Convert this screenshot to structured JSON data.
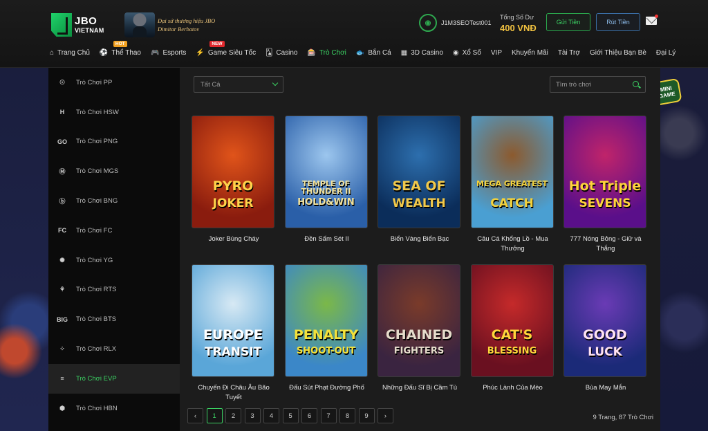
{
  "header": {
    "logo": {
      "line1": "JBO",
      "line2": "VIETNAM"
    },
    "ambassador": {
      "line1": "Đại sứ thương hiệu JBO",
      "line2": "Dimitar Berbatov"
    },
    "user": {
      "name": "J1M3SEOTest001"
    },
    "balance": {
      "label": "Tổng Số Dư",
      "value": "400 VNĐ"
    },
    "deposit_label": "Gửi Tiền",
    "withdraw_label": "Rút Tiền"
  },
  "nav": [
    {
      "label": "Trang Chủ",
      "icon": "home-icon",
      "glyph": "⌂"
    },
    {
      "label": "Thể Thao",
      "icon": "soccer-ball-icon",
      "glyph": "⚽",
      "badge": "HOT"
    },
    {
      "label": "Esports",
      "icon": "gamepad-icon",
      "glyph": "🎮"
    },
    {
      "label": "Game Siêu Tốc",
      "icon": "lightning-icon",
      "glyph": "⚡",
      "badge": "NEW"
    },
    {
      "label": "Casino",
      "icon": "cards-icon",
      "glyph": "🂡"
    },
    {
      "label": "Trò Chơi",
      "icon": "slot-machine-icon",
      "glyph": "🎰"
    },
    {
      "label": "Bắn Cá",
      "icon": "fish-icon",
      "glyph": "🐟"
    },
    {
      "label": "3D Casino",
      "icon": "cube-icon",
      "glyph": "▦"
    },
    {
      "label": "Xổ Số",
      "icon": "lottery-ball-icon",
      "glyph": "◉"
    },
    {
      "label": "VIP"
    },
    {
      "label": "Khuyến Mãi"
    },
    {
      "label": "Tài Trợ"
    },
    {
      "label": "Giới Thiệu Bạn Bè"
    },
    {
      "label": "Đại Lý"
    }
  ],
  "mini_game": {
    "line1": "MINI",
    "line2": "GAME"
  },
  "sidebar": [
    {
      "label": "Trò Chơi PP",
      "icon": "pp-logo-icon",
      "glyph": "☉"
    },
    {
      "label": "Trò Chơi HSW",
      "icon": "hsw-logo-icon",
      "glyph": "H"
    },
    {
      "label": "Trò Chơi PNG",
      "icon": "png-logo-icon",
      "glyph": "GO"
    },
    {
      "label": "Trò Chơi MGS",
      "icon": "mgs-logo-icon",
      "glyph": "Ⓜ"
    },
    {
      "label": "Trò Chơi BNG",
      "icon": "bng-logo-icon",
      "glyph": "ⓑ"
    },
    {
      "label": "Trò Chơi FC",
      "icon": "fc-logo-icon",
      "glyph": "FC"
    },
    {
      "label": "Trò Chơi YG",
      "icon": "yg-logo-icon",
      "glyph": "✺"
    },
    {
      "label": "Trò Chơi RTS",
      "icon": "rts-logo-icon",
      "glyph": "⚘"
    },
    {
      "label": "Trò Chơi BTS",
      "icon": "bts-logo-icon",
      "glyph": "BIG"
    },
    {
      "label": "Trò Chơi RLX",
      "icon": "rlx-logo-icon",
      "glyph": "⁘"
    },
    {
      "label": "Trò Chơi EVP",
      "icon": "evp-logo-icon",
      "glyph": "≡",
      "active": true
    },
    {
      "label": "Trò Chơi HBN",
      "icon": "hbn-logo-icon",
      "glyph": "⬢"
    }
  ],
  "filter": {
    "selected": "Tất Cả"
  },
  "search": {
    "placeholder": "Tìm trò chơi"
  },
  "games": [
    {
      "name": "Joker Bùng Cháy",
      "title": "PYRO",
      "sub": "JOKER",
      "bg": "#8a1c0e",
      "bg2": "#e0541a",
      "fg": "#ffd24a"
    },
    {
      "name": "Đền Sấm Sét II",
      "title": "TEMPLE OF THUNDER II",
      "sub": "HOLD&WIN",
      "bg": "#2a5fa8",
      "bg2": "#9cc6ee",
      "fg": "#f3e29a"
    },
    {
      "name": "Biển Vàng Biển Bạc",
      "title": "SEA OF",
      "sub": "WEALTH",
      "bg": "#0b2d5a",
      "bg2": "#2d6fae",
      "fg": "#f1c94b"
    },
    {
      "name": "Câu Cá Khổng Lồ - Mua Thưởng",
      "title": "MEGA GREATEST",
      "sub": "CATCH",
      "bg": "#4a9fd2",
      "bg2": "#8c5a2e",
      "fg": "#f4d23b"
    },
    {
      "name": "777 Nóng Bỏng - Giữ và Thắng",
      "title": "Hot Triple",
      "sub": "SEVENS",
      "bg": "#5a0f8a",
      "bg2": "#c0246a",
      "fg": "#ffd43b"
    },
    {
      "name": "Chuyến Đi Châu Âu Bão Tuyết",
      "title": "EUROPE",
      "sub": "TRANSIT",
      "bg": "#5aa6d8",
      "bg2": "#d7e9f4",
      "fg": "#ffffff"
    },
    {
      "name": "Đấu Sút Phạt Đường Phố",
      "title": "PENALTY",
      "sub": "SHOOT-OUT",
      "bg": "#3b87c8",
      "bg2": "#7bb848",
      "fg": "#f4e23a"
    },
    {
      "name": "Những Đấu Sĩ Bị Cầm Tù",
      "title": "CHAINED",
      "sub": "FIGHTERS",
      "bg": "#3a2440",
      "bg2": "#7a3b2a",
      "fg": "#e6dccb"
    },
    {
      "name": "Phúc Lành Của Mèo",
      "title": "CAT'S",
      "sub": "BLESSING",
      "bg": "#6a1020",
      "bg2": "#c52a2a",
      "fg": "#ffd53b"
    },
    {
      "name": "Bùa May Mắn",
      "title": "GOOD",
      "sub": "LUCK",
      "bg": "#1b2a78",
      "bg2": "#6a3bb5",
      "fg": "#ffe2f2"
    }
  ],
  "pagination": {
    "prev": "‹",
    "next": "›",
    "pages": [
      "1",
      "2",
      "3",
      "4",
      "5",
      "6",
      "7",
      "8",
      "9"
    ],
    "current": "1",
    "summary": "9 Trang,  87 Trò Chơi"
  }
}
